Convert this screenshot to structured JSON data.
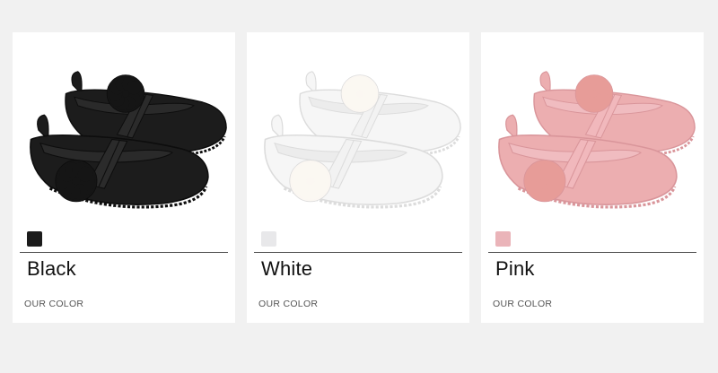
{
  "products": [
    {
      "name": "Black",
      "label": "OUR COLOR",
      "swatch": "#1b1b1b",
      "shoe": "#1c1c1c",
      "shoe_shade": "#0d0d0d",
      "lining": "#2a2a2a",
      "pom": "#151515",
      "strap": "#2b2b2b"
    },
    {
      "name": "White",
      "label": "OUR COLOR",
      "swatch": "#e8e8ea",
      "shoe": "#f6f6f6",
      "shoe_shade": "#dcdcdc",
      "lining": "#ececec",
      "pom": "#fbf7f2",
      "strap": "#f2f2f2"
    },
    {
      "name": "Pink",
      "label": "OUR COLOR",
      "swatch": "#eab4b9",
      "shoe": "#ecaeb0",
      "shoe_shade": "#d9959a",
      "lining": "#f0bcc0",
      "pom": "#e79c98",
      "strap": "#f1b8bc"
    }
  ]
}
